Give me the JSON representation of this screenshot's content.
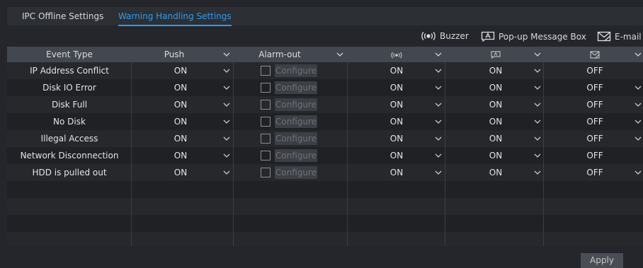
{
  "tabs": [
    {
      "label": "IPC Offline Settings",
      "active": false
    },
    {
      "label": "Warning Handling Settings",
      "active": true
    }
  ],
  "legend": {
    "buzzer": {
      "icon": "buzzer-icon",
      "label": "Buzzer"
    },
    "popup": {
      "icon": "popup-message-icon",
      "label": "Pop-up Message Box"
    },
    "email": {
      "icon": "email-icon",
      "label": "E-mail"
    }
  },
  "columns": {
    "event_type": "Event Type",
    "push": "Push",
    "alarm_out": "Alarm-out",
    "buzzer_icon": "buzzer-icon",
    "popup_icon": "popup-message-icon",
    "email_icon": "email-icon"
  },
  "rows": [
    {
      "event": "IP Address Conflict",
      "push": "ON",
      "configure": "Configure",
      "buzzer": "ON",
      "popup": "ON",
      "email": "OFF"
    },
    {
      "event": "Disk IO Error",
      "push": "ON",
      "configure": "Configure",
      "buzzer": "ON",
      "popup": "ON",
      "email": "OFF"
    },
    {
      "event": "Disk Full",
      "push": "ON",
      "configure": "Configure",
      "buzzer": "ON",
      "popup": "ON",
      "email": "OFF"
    },
    {
      "event": "No Disk",
      "push": "ON",
      "configure": "Configure",
      "buzzer": "ON",
      "popup": "ON",
      "email": "OFF"
    },
    {
      "event": "Illegal Access",
      "push": "ON",
      "configure": "Configure",
      "buzzer": "ON",
      "popup": "ON",
      "email": "OFF"
    },
    {
      "event": "Network Disconnection",
      "push": "ON",
      "configure": "Configure",
      "buzzer": "ON",
      "popup": "ON",
      "email": "OFF"
    },
    {
      "event": "HDD is pulled out",
      "push": "ON",
      "configure": "Configure",
      "buzzer": "ON",
      "popup": "ON",
      "email": "OFF"
    }
  ],
  "apply_label": "Apply",
  "colors": {
    "accent": "#2a9df4",
    "background": "#24262b",
    "header": "#43474f"
  }
}
